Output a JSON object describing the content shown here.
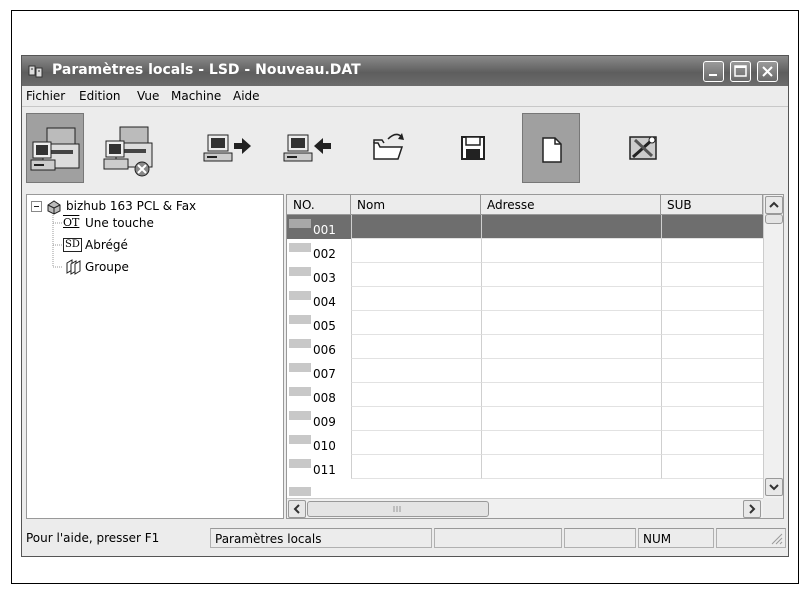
{
  "window": {
    "title": "Paramètres locals - LSD - Nouveau.DAT"
  },
  "menu": [
    "Fichier",
    "Edition",
    "Vue",
    "Machine",
    "Aide"
  ],
  "toolbar": {
    "buttons": [
      {
        "name": "copier-machine-icon",
        "pressed": true
      },
      {
        "name": "copier-delete-icon",
        "pressed": false
      },
      {
        "name": "send-to-machine-icon",
        "pressed": false
      },
      {
        "name": "receive-from-machine-icon",
        "pressed": false
      },
      {
        "name": "open-folder-icon",
        "pressed": false
      },
      {
        "name": "save-floppy-icon",
        "pressed": false
      },
      {
        "name": "new-document-icon",
        "pressed": true
      },
      {
        "name": "settings-tools-icon",
        "pressed": false
      }
    ]
  },
  "tree": {
    "root": "bizhub 163 PCL & Fax",
    "children": [
      {
        "icon_text": "OT",
        "label": "Une touche"
      },
      {
        "icon_text": "SD",
        "label": "Abrégé"
      },
      {
        "icon_text": "",
        "label": "Groupe"
      }
    ]
  },
  "list": {
    "columns": [
      "NO.",
      "Nom",
      "Adresse",
      "SUB"
    ],
    "rows": [
      {
        "no": "001",
        "selected": true
      },
      {
        "no": "002"
      },
      {
        "no": "003"
      },
      {
        "no": "004"
      },
      {
        "no": "005"
      },
      {
        "no": "006"
      },
      {
        "no": "007"
      },
      {
        "no": "008"
      },
      {
        "no": "009"
      },
      {
        "no": "010"
      },
      {
        "no": "011"
      }
    ]
  },
  "status": {
    "help": "Pour l'aide, presser F1",
    "mode": "Paramètres locals",
    "num": "NUM"
  }
}
